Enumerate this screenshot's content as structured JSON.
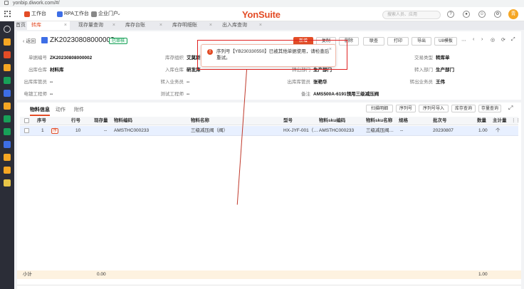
{
  "browser": {
    "url": "yonbip.diwork.com/#/"
  },
  "appbar": {
    "chips": [
      "工作台",
      "RPA工作台",
      "企业门户"
    ],
    "logo": "YonSuite",
    "search_placeholder": "搜索人员、应用",
    "avatar_text": "青"
  },
  "tabs": {
    "home": "首页",
    "items": [
      {
        "label": "转库",
        "active": true
      },
      {
        "label": "现存量查询",
        "active": false
      },
      {
        "label": "库存台账",
        "active": false
      },
      {
        "label": "库存明细账",
        "active": false
      },
      {
        "label": "出入库查询",
        "active": false
      }
    ]
  },
  "doc": {
    "back_label": "返回",
    "code": "ZK20230808000002",
    "status": "已审核",
    "buttons": [
      "新增",
      "复制",
      "删除",
      "联查",
      "打印",
      "导出",
      "U8模板"
    ]
  },
  "fields": [
    {
      "label": "单据编号",
      "value": "ZK20230808000002"
    },
    {
      "label": "库存组织",
      "value": "艾莫斯"
    },
    {
      "label": "交易类型",
      "value": "转库单"
    },
    {
      "label": "出库仓库",
      "value": "材料库"
    },
    {
      "label": "入库仓库",
      "value": "研发库"
    },
    {
      "label": "转出部门",
      "value": "生产部门"
    },
    {
      "label": "转入部门",
      "value": "生产部门"
    },
    {
      "label": "出库库管员",
      "value": "--"
    },
    {
      "label": "转入业务员",
      "value": "--"
    },
    {
      "label": "出库库管员",
      "value": "张艳华"
    },
    {
      "label": "转出业务员",
      "value": "王伟"
    },
    {
      "label": "电镀工程师",
      "value": "--"
    },
    {
      "label": "测试工程师",
      "value": "--"
    },
    {
      "label": "备注",
      "value": "AMS500A-6191领用三级减压阀"
    }
  ],
  "lines": {
    "subtabs": [
      "物料信息",
      "动作",
      "附件"
    ],
    "buttons": [
      "扫描明细",
      "序列号",
      "序列号导入",
      "库存查询",
      "存量查询"
    ],
    "columns": [
      "序号",
      "行号",
      "现存量",
      "物料编码",
      "物料名称",
      "型号",
      "物料sku编码",
      "物料sku名称",
      "规格",
      "批次号",
      "数量",
      "主计量"
    ],
    "rows": [
      {
        "seq": "1",
        "tag": "序",
        "line": "10",
        "stock": "--",
        "code": "AMSTHC000233",
        "name": "三级减压阀（阀）",
        "model": "HX-JYF-001（…",
        "sku": "AMSTHC000233",
        "sku_name": "三级减压阀…",
        "spec": "--",
        "batch": "20230807",
        "qty": "1.00",
        "unit": "个"
      }
    ],
    "subtotal_label": "小计",
    "subtotal_stock": "0.00",
    "subtotal_qty": "1.00"
  },
  "toast": {
    "message": "序列号【YB230330550】已被其他单据使用，请检查后重试。",
    "icon": "error-icon"
  }
}
